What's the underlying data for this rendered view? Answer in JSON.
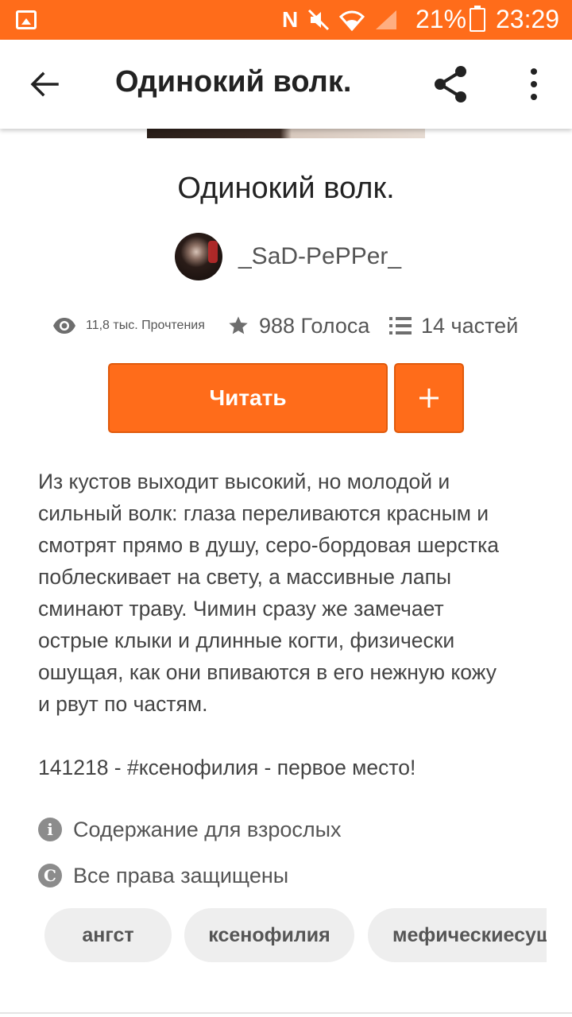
{
  "status_bar": {
    "battery": "21%",
    "time": "23:29",
    "accent_color": "#ff6c1a"
  },
  "app_bar": {
    "title": "Одинокий волк.",
    "icons": [
      "back-arrow-icon",
      "share-icon",
      "more-vert-icon"
    ]
  },
  "story": {
    "title": "Одинокий волк.",
    "author": "_SaD-PePPer_",
    "stats": {
      "reads": "11,8 тыс. Прочтения",
      "votes": "988 Голоса",
      "parts": "14 частей"
    },
    "read_button": "Читать",
    "add_button": "+",
    "description_lines": [
      "Из кустов выходит высокий, но молодой и",
      "сильный волк: глаза переливаются красным и",
      "смотрят прямо в душу, серо-бордовая шерстка",
      "поблескивает на свету, а массивные лапы",
      "сминают траву. Чимин сразу же замечает",
      "острые клыки и длинные когти, физически",
      "ошущая, как они впиваются в его нежную кожу",
      "и рвут по частям."
    ],
    "dedication": "141218 - #ксенофилия - первое место!",
    "mature_notice": "Содержание для взрослых",
    "copyright": "Все права защищены",
    "tags": [
      "ангст",
      "ксенофилия",
      "мефическиесущ"
    ]
  }
}
